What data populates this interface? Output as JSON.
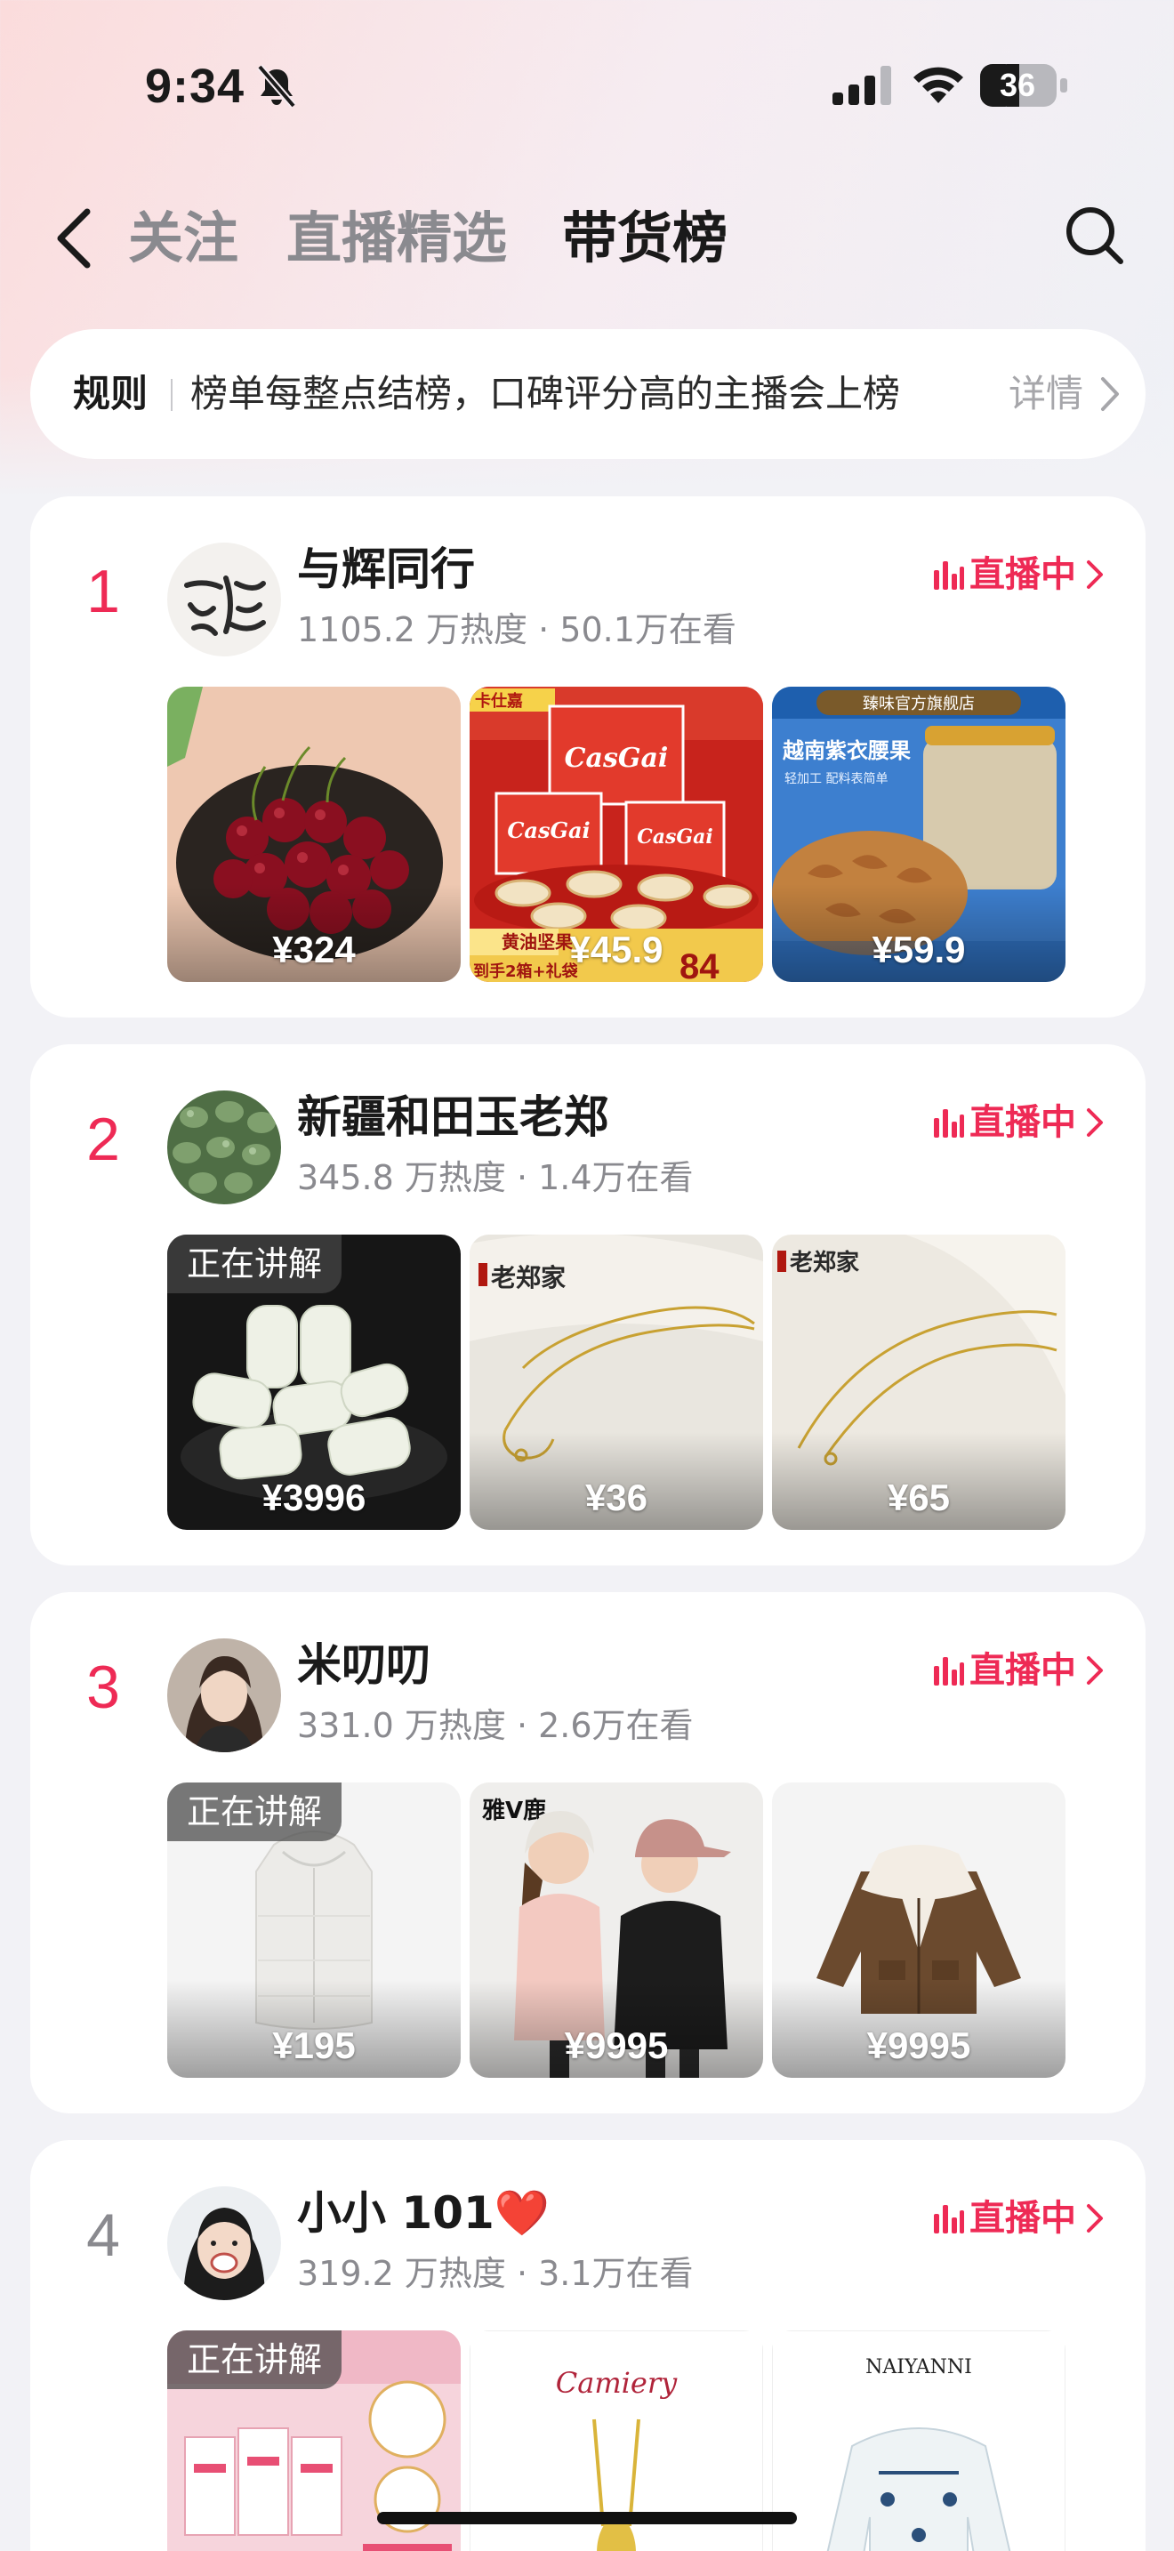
{
  "status_bar": {
    "time": "9:34",
    "battery": "36"
  },
  "nav": {
    "tabs": [
      {
        "label": "关注",
        "active": false
      },
      {
        "label": "直播精选",
        "active": false
      },
      {
        "label": "带货榜",
        "active": true
      }
    ]
  },
  "rules": {
    "label": "规则",
    "text": "榜单每整点结榜，口碑评分高的主播会上榜",
    "detail": "详情"
  },
  "colors": {
    "accent": "#ee2a55",
    "muted": "#8a8a8f"
  },
  "rankings": [
    {
      "rank": "1",
      "name": "与辉同行",
      "stats": "1105.2 万热度 · 50.1万在看",
      "live_label": "直播中",
      "products": [
        {
          "price": "¥324"
        },
        {
          "price": "¥45.9"
        },
        {
          "price": "¥59.9"
        }
      ]
    },
    {
      "rank": "2",
      "name": "新疆和田玉老郑",
      "stats": "345.8 万热度 · 1.4万在看",
      "live_label": "直播中",
      "products": [
        {
          "price": "¥3996",
          "badge": "正在讲解"
        },
        {
          "price": "¥36"
        },
        {
          "price": "¥65"
        }
      ]
    },
    {
      "rank": "3",
      "name": "米叨叨",
      "stats": "331.0 万热度 · 2.6万在看",
      "live_label": "直播中",
      "products": [
        {
          "price": "¥195",
          "badge": "正在讲解"
        },
        {
          "price": "¥9995"
        },
        {
          "price": "¥9995"
        }
      ]
    },
    {
      "rank": "4",
      "name": "小小 101❤️",
      "stats": "319.2 万热度 · 3.1万在看",
      "live_label": "直播中",
      "products": [
        {
          "badge": "正在讲解"
        },
        {},
        {}
      ]
    }
  ],
  "product_art": {
    "brand_cookies": "CasGai",
    "brand_cookies_top": "卡仕嘉",
    "cookies_banner": "黄油坚果",
    "cookies_sub": "到手2箱+礼袋",
    "cookies_number": "84",
    "nuts_store": "臻味官方旗舰店",
    "nuts_title": "越南紫衣腰果",
    "nuts_sub": "轻加工 配料表简单",
    "jade_logo": "老郑家",
    "kids_brand": "雅V鹿",
    "brand_camiery": "Camiery",
    "brand_naiyanni": "NAIYANNI"
  }
}
